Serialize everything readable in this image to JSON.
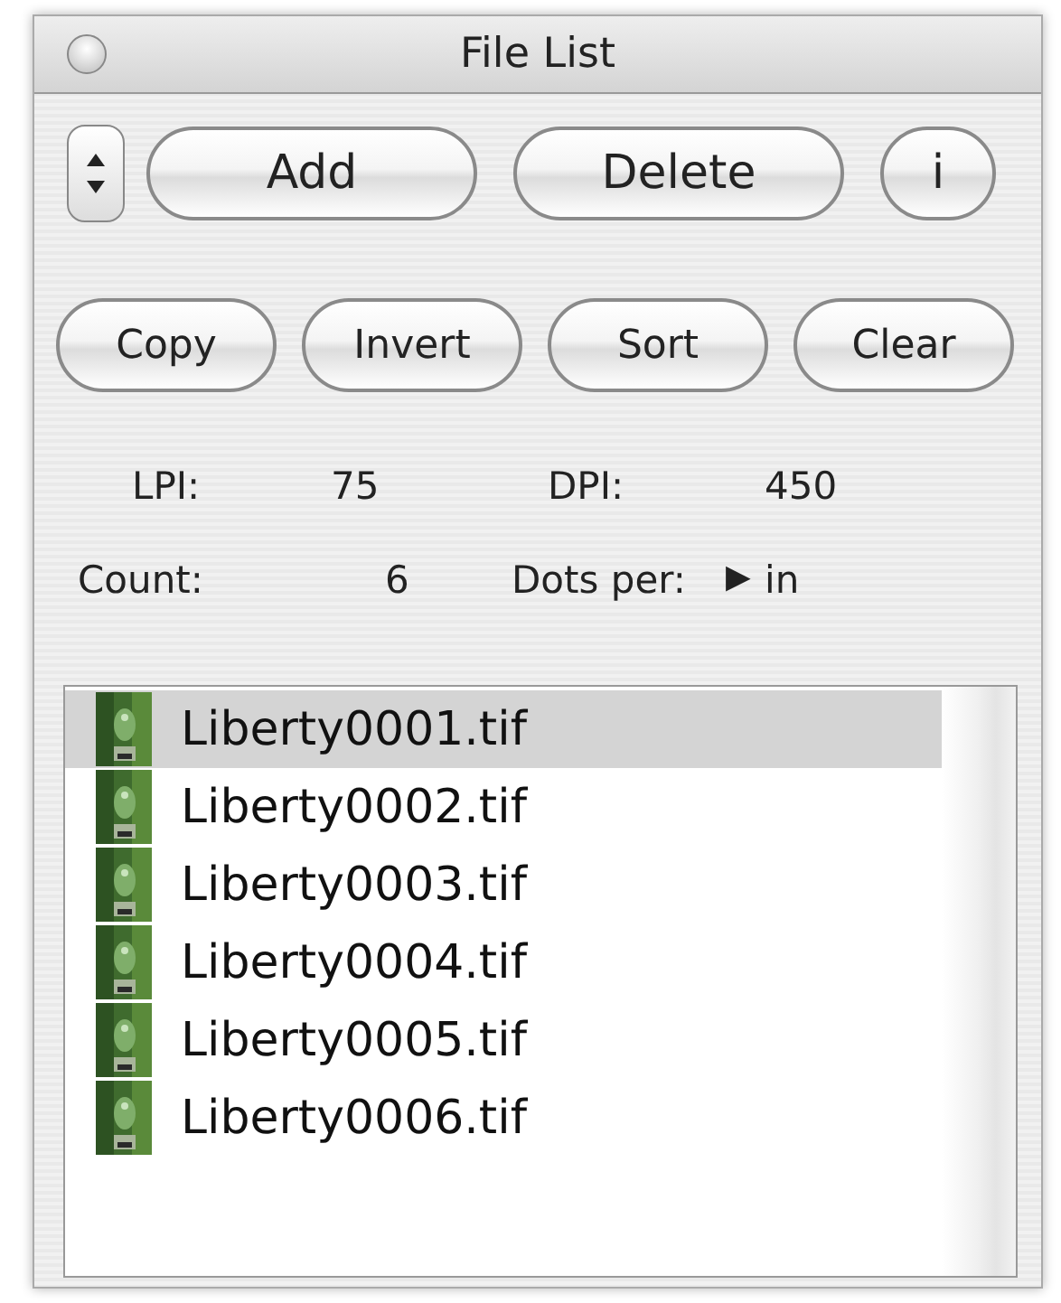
{
  "window": {
    "title": "File List"
  },
  "top_buttons": [
    {
      "label": "Add",
      "kind": "wide"
    },
    {
      "label": "Delete",
      "kind": "wide"
    },
    {
      "label": "i",
      "kind": "round"
    }
  ],
  "action_buttons": [
    {
      "label": "Copy"
    },
    {
      "label": "Invert"
    },
    {
      "label": "Sort"
    },
    {
      "label": "Clear"
    }
  ],
  "info": {
    "lpi_label": "LPI:",
    "lpi": "75",
    "dpi_label": "DPI:",
    "dpi": "450",
    "count_label": "Count:",
    "count": "6",
    "dots_label": "Dots per:",
    "dots_toggle": "▶",
    "dots_unit": "in"
  },
  "files": [
    {
      "name": "Liberty0001.tif",
      "selected": true
    },
    {
      "name": "Liberty0002.tif",
      "selected": false
    },
    {
      "name": "Liberty0003.tif",
      "selected": false
    },
    {
      "name": "Liberty0004.tif",
      "selected": false
    },
    {
      "name": "Liberty0005.tif",
      "selected": false
    },
    {
      "name": "Liberty0006.tif",
      "selected": false
    }
  ]
}
